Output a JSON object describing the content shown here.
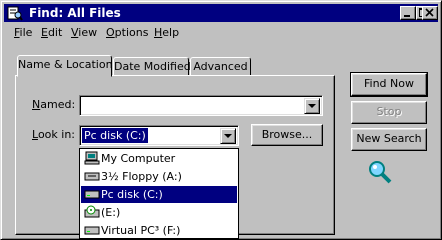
{
  "window": {
    "title": "Find: All Files"
  },
  "menu": [
    {
      "label": "File",
      "key": "F",
      "rest": "ile"
    },
    {
      "label": "Edit",
      "key": "E",
      "rest": "dit"
    },
    {
      "label": "View",
      "key": "V",
      "rest": "iew"
    },
    {
      "label": "Options",
      "key": "O",
      "rest": "ptions"
    },
    {
      "label": "Help",
      "key": "H",
      "rest": "elp"
    }
  ],
  "tabs": [
    "Name & Location",
    "Date Modified",
    "Advanced"
  ],
  "form": {
    "named_label": "Named:",
    "named_value": "",
    "lookin_label": "Look in:",
    "lookin_value": "Pc disk (C:)",
    "browse_label": "Browse..."
  },
  "buttons": {
    "find_now": "Find Now",
    "stop": "Stop",
    "new_search": "New Search"
  },
  "dropdown_items": [
    {
      "label": "My Computer",
      "icon": "computer-icon",
      "selected": false
    },
    {
      "label": "3½ Floppy (A:)",
      "icon": "floppy-drive-icon",
      "selected": false
    },
    {
      "label": "Pc disk (C:)",
      "icon": "hard-drive-icon",
      "selected": true
    },
    {
      "label": "(E:)",
      "icon": "cd-drive-icon",
      "selected": false
    },
    {
      "label": "Virtual PC³ (F:)",
      "icon": "hard-drive-icon",
      "selected": false
    }
  ],
  "colors": {
    "titlebar": "#000080",
    "face": "#c0c0c0",
    "selection": "#000080"
  }
}
